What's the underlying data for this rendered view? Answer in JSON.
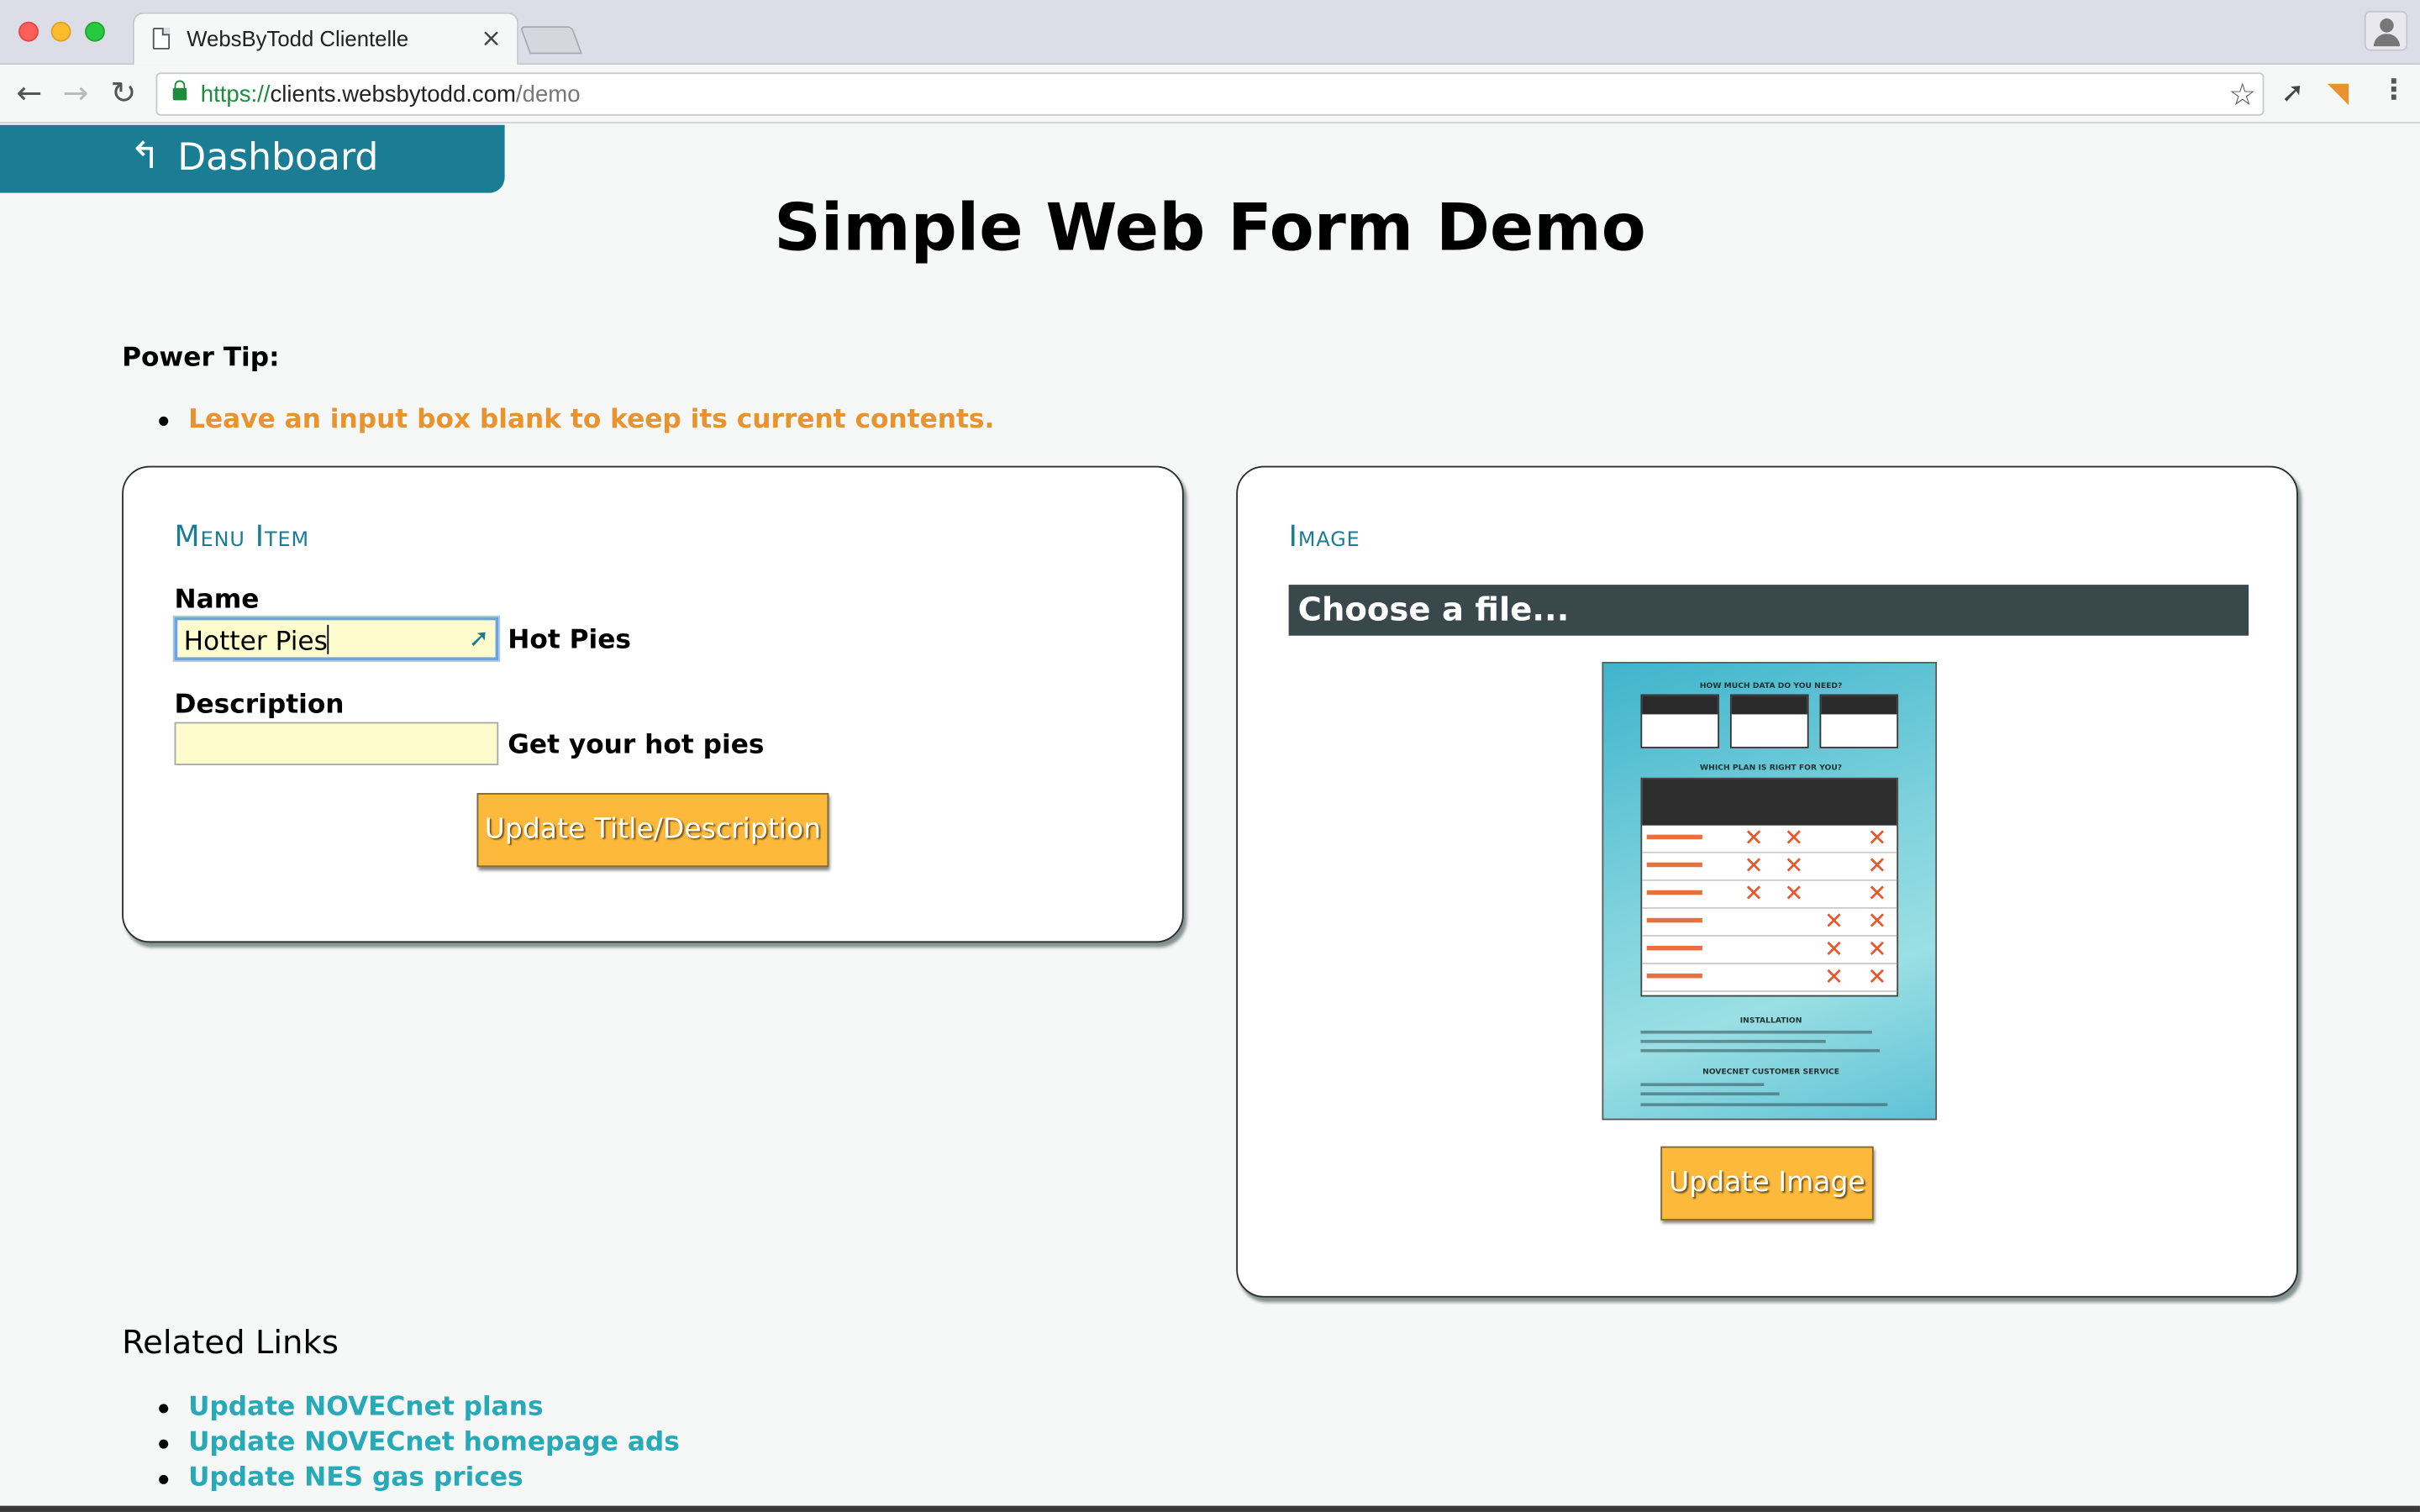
{
  "browser": {
    "tab_title": "WebsByTodd Clientelle",
    "tab_close": "×",
    "url_scheme": "https://",
    "url_host": "clients.websbytodd.com",
    "url_path": "/demo",
    "icons": [
      "back-icon",
      "forward-icon",
      "reload-icon",
      "lock-icon",
      "star-icon",
      "extension-icon",
      "rss-icon",
      "menu-icon",
      "profile-icon"
    ]
  },
  "page": {
    "dashboard_label": "Dashboard",
    "title": "Simple Web Form Demo",
    "power_tip_heading": "Power Tip:",
    "power_tips": [
      "Leave an input box blank to keep its current contents."
    ]
  },
  "menu_item": {
    "heading": "Menu Item",
    "name_label": "Name",
    "name_value": "Hotter Pies",
    "name_current": "Hot Pies",
    "description_label": "Description",
    "description_value": "",
    "description_current": "Get your hot pies",
    "update_button": "Update Title/Description"
  },
  "image": {
    "heading": "Image",
    "choose_file": "Choose a file...",
    "preview_heading_1": "HOW MUCH DATA DO YOU NEED?",
    "preview_heading_2": "WHICH PLAN IS RIGHT FOR YOU?",
    "preview_heading_3": "INSTALLATION",
    "preview_heading_4": "NOVECNET CUSTOMER SERVICE",
    "update_button": "Update Image"
  },
  "related": {
    "heading": "Related Links",
    "links": [
      "Update NOVECnet plans",
      "Update NOVECnet homepage ads",
      "Update NES gas prices"
    ]
  },
  "colors": {
    "accent": "#1a7d93",
    "tip": "#e8932e",
    "button": "#fdb93b",
    "link": "#28a9b7",
    "input_bg": "#fefccc"
  }
}
